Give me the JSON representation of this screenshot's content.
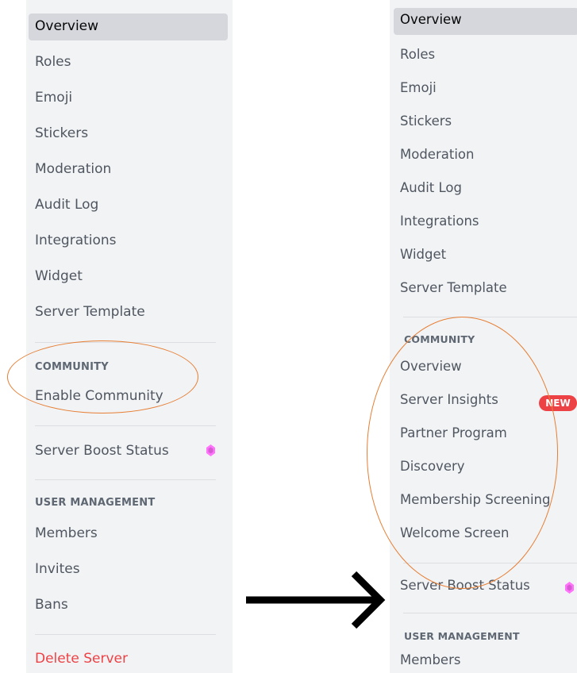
{
  "left_panel": {
    "items": [
      {
        "label": "Overview"
      },
      {
        "label": "Roles"
      },
      {
        "label": "Emoji"
      },
      {
        "label": "Stickers"
      },
      {
        "label": "Moderation"
      },
      {
        "label": "Audit Log"
      },
      {
        "label": "Integrations"
      },
      {
        "label": "Widget"
      },
      {
        "label": "Server Template"
      }
    ],
    "community_header": "COMMUNITY",
    "enable_community": "Enable Community",
    "boost_status": "Server Boost Status",
    "user_management_header": "USER MANAGEMENT",
    "user_items": [
      {
        "label": "Members"
      },
      {
        "label": "Invites"
      },
      {
        "label": "Bans"
      }
    ],
    "delete_server": "Delete Server"
  },
  "right_panel": {
    "items": [
      {
        "label": "Overview"
      },
      {
        "label": "Roles"
      },
      {
        "label": "Emoji"
      },
      {
        "label": "Stickers"
      },
      {
        "label": "Moderation"
      },
      {
        "label": "Audit Log"
      },
      {
        "label": "Integrations"
      },
      {
        "label": "Widget"
      },
      {
        "label": "Server Template"
      }
    ],
    "community_header": "COMMUNITY",
    "community_items": [
      {
        "label": "Overview"
      },
      {
        "label": "Server Insights"
      },
      {
        "label": "Partner Program"
      },
      {
        "label": "Discovery"
      },
      {
        "label": "Membership Screening"
      },
      {
        "label": "Welcome Screen"
      }
    ],
    "new_badge": "NEW",
    "boost_status": "Server Boost Status",
    "user_management_header": "USER MANAGEMENT",
    "user_items": [
      {
        "label": "Members"
      }
    ]
  },
  "colors": {
    "sidebar_bg": "#f2f3f5",
    "selected_bg": "#d5d7dc",
    "danger": "#ed4245",
    "highlight_ellipse": "#e67e33",
    "boost_gem": "#ff73fa"
  },
  "icons": [
    "boost-gem-icon",
    "right-arrow-icon"
  ]
}
